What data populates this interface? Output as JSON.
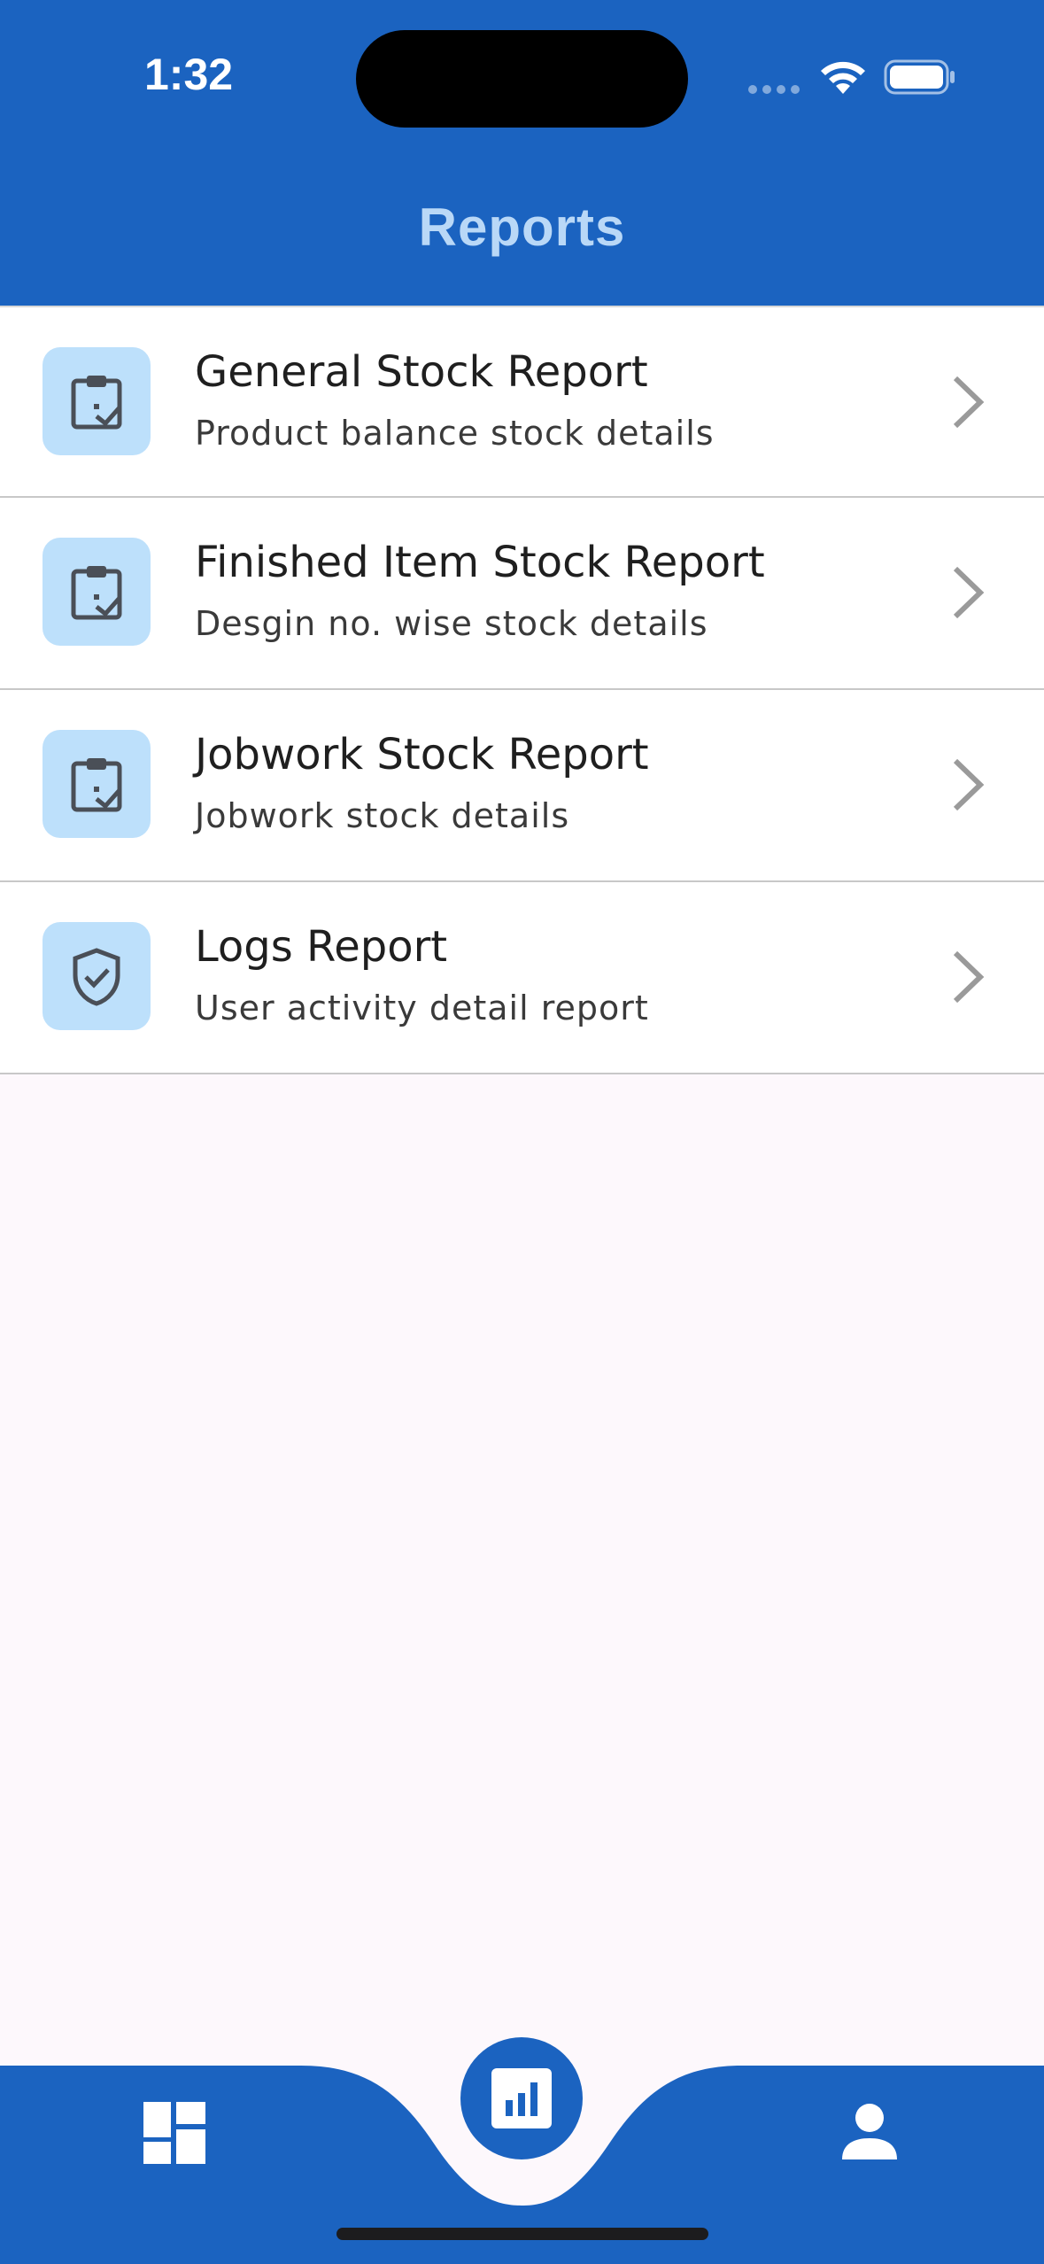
{
  "status_bar": {
    "time": "1:32"
  },
  "header": {
    "title": "Reports"
  },
  "colors": {
    "primary": "#1b63c0",
    "title_text": "#b9d8f7",
    "icon_bg": "#bde0fb",
    "background": "#fdf8fc"
  },
  "reports": [
    {
      "title": "General Stock Report",
      "subtitle": "Product balance stock details",
      "icon": "clipboard-check-icon"
    },
    {
      "title": "Finished Item Stock Report",
      "subtitle": "Desgin no. wise stock details",
      "icon": "clipboard-check-icon"
    },
    {
      "title": "Jobwork Stock Report",
      "subtitle": "Jobwork stock details",
      "icon": "clipboard-check-icon"
    },
    {
      "title": "Logs Report",
      "subtitle": "User activity detail report",
      "icon": "shield-check-icon"
    }
  ],
  "bottom_nav": {
    "items": [
      {
        "icon": "dashboard-icon",
        "active": false
      },
      {
        "icon": "bar-chart-icon",
        "active": true
      },
      {
        "icon": "person-icon",
        "active": false
      }
    ]
  }
}
